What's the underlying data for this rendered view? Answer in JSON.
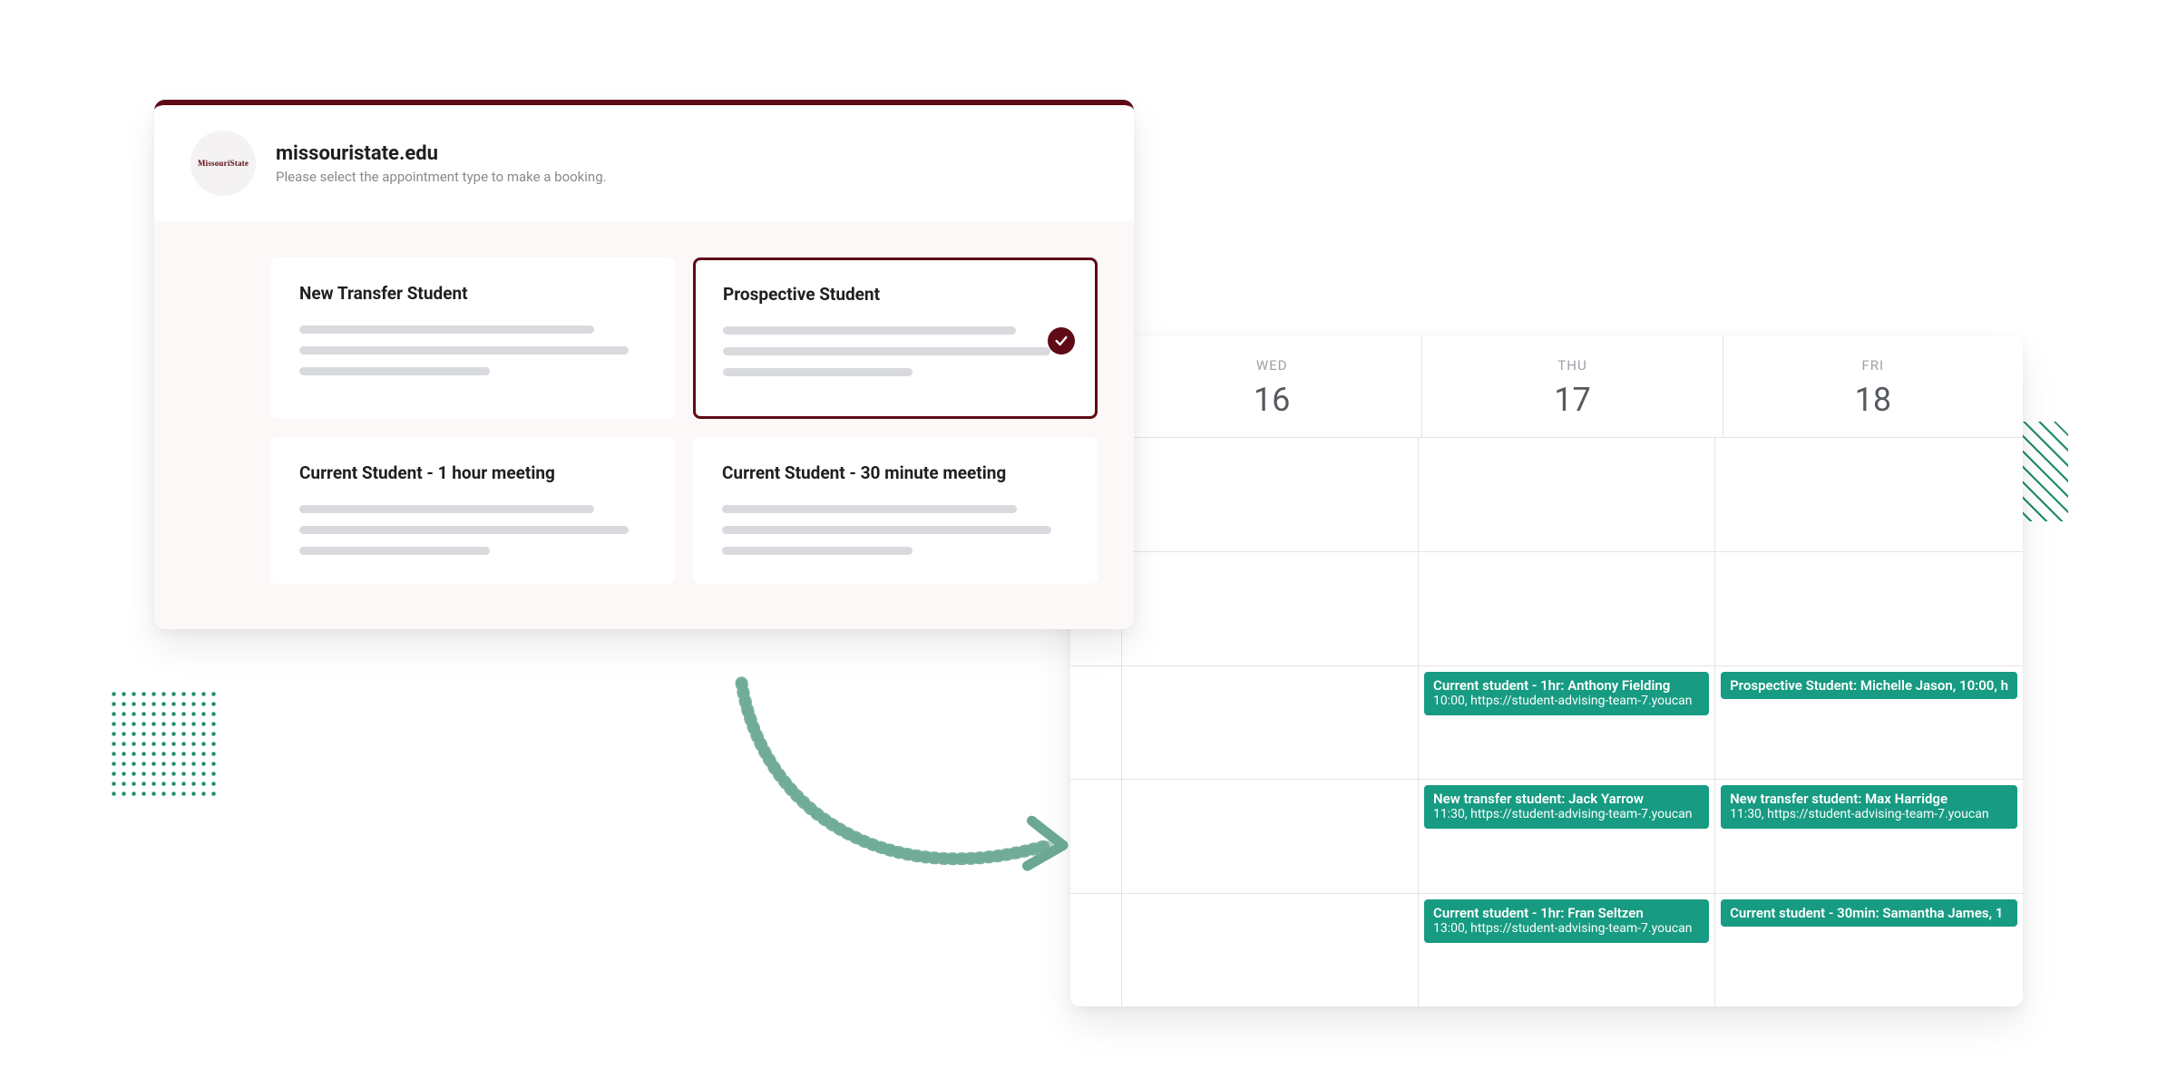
{
  "booking": {
    "logo_label": "MissouriState",
    "title": "missouristate.edu",
    "subtitle": "Please select the appointment type to make a booking.",
    "options": [
      {
        "label": "New Transfer Student",
        "selected": false
      },
      {
        "label": "Prospective Student",
        "selected": true
      },
      {
        "label": "Current Student - 1 hour meeting",
        "selected": false
      },
      {
        "label": "Current Student - 30 minute meeting",
        "selected": false
      }
    ]
  },
  "calendar": {
    "days": [
      {
        "dow": "WED",
        "num": "16"
      },
      {
        "dow": "THU",
        "num": "17"
      },
      {
        "dow": "FRI",
        "num": "18"
      }
    ],
    "events": {
      "thu": [
        {
          "row": 2,
          "title": "Current student - 1hr: Anthony Fielding",
          "sub": "10:00, https://student-advising-team-7.youcan"
        },
        {
          "row": 3,
          "title": "New transfer student: Jack Yarrow",
          "sub": "11:30, https://student-advising-team-7.youcan"
        },
        {
          "row": 4,
          "title": "Current student - 1hr: Fran Seltzen",
          "sub": "13:00, https://student-advising-team-7.youcan"
        }
      ],
      "fri": [
        {
          "row": 2,
          "title": "Prospective Student: Michelle Jason, 10:00, h",
          "sub": ""
        },
        {
          "row": 3,
          "title": "New transfer student: Max Harridge",
          "sub": "11:30, https://student-advising-team-7.youcan"
        },
        {
          "row": 4,
          "title": "Current student - 30min: Samantha James, 1",
          "sub": ""
        }
      ]
    }
  }
}
